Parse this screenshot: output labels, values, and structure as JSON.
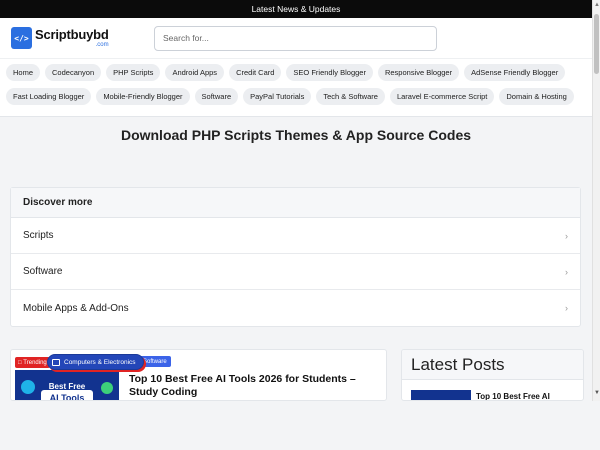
{
  "topbar": {
    "text": "Latest News & Updates"
  },
  "header": {
    "logo_icon": "</>",
    "logo_name": "Scriptbuybd",
    "logo_sub": ".com",
    "search_placeholder": "Search for..."
  },
  "tags": [
    "Home",
    "Codecanyon",
    "PHP Scripts",
    "Android Apps",
    "Credit Card",
    "SEO Friendly Blogger",
    "Responsive Blogger",
    "AdSense Friendly Blogger",
    "Fast Loading Blogger",
    "Mobile-Friendly Blogger",
    "Software",
    "PayPal Tutorials",
    "Tech & Software",
    "Laravel E-commerce Script",
    "Domain & Hosting"
  ],
  "page_title": "Download PHP Scripts Themes & App Source Codes",
  "discover": {
    "heading": "Discover more",
    "items": [
      "Scripts",
      "Software",
      "Mobile Apps & Add-Ons"
    ]
  },
  "post": {
    "trending_label": "Trending",
    "category_label": "Computers & Electronics",
    "software_label": "Software",
    "thumb_line1": "Best Free",
    "thumb_line2": "AI Tools",
    "title": "Top 10 Best Free AI Tools 2026 for Students – Study Coding"
  },
  "latest": {
    "heading": "Latest Posts",
    "first_title": "Top 10 Best Free AI"
  },
  "colors": {
    "brand_blue": "#2b6fe0",
    "trending_red": "#e02424",
    "category_blue": "#2346b8"
  }
}
